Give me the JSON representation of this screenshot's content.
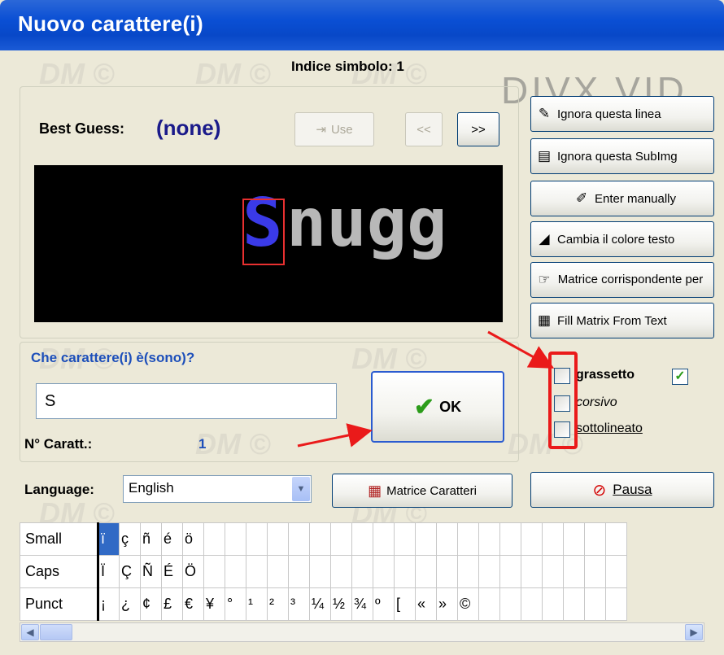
{
  "window": {
    "title": "Nuovo carattere(i)"
  },
  "watermark": {
    "text": "DM ©",
    "logo": "DIVX VID"
  },
  "symbol_index": "Indice simbolo: 1",
  "best_guess": {
    "label": "Best Guess:",
    "value": "(none)"
  },
  "nav": {
    "use_label": "Use",
    "prev_label": "<<",
    "next_label": ">>"
  },
  "preview": {
    "selected_char": "S",
    "rest_text": "nugg"
  },
  "side_buttons": [
    {
      "label": "Ignora questa linea",
      "icon": "eraser-icon"
    },
    {
      "label": "Ignora questa SubImg",
      "icon": "document-icon"
    },
    {
      "label": "Enter manually",
      "icon": "pencil-icon"
    },
    {
      "label": "Cambia il colore testo",
      "icon": "color-pen-icon"
    },
    {
      "label": "Matrice corrispondente per",
      "icon": "hand-pointer-icon"
    },
    {
      "label": "Fill Matrix From Text",
      "icon": "matrix-icon"
    }
  ],
  "question": {
    "label": "Che carattere(i) è(sono)?"
  },
  "char_input": {
    "value": "S"
  },
  "count": {
    "label": "N° Caratt.:",
    "value": "1"
  },
  "ok_button": {
    "label": "OK"
  },
  "style_checkboxes": [
    {
      "label": "grassetto",
      "checked": false,
      "extra_checked": true
    },
    {
      "label": "corsivo",
      "checked": false
    },
    {
      "label": "sottolineato",
      "checked": false
    }
  ],
  "language": {
    "label": "Language:",
    "selected": "English"
  },
  "matrix_button": {
    "label": "Matrice Caratteri"
  },
  "pause_button": {
    "label": "Pausa"
  },
  "char_table": {
    "rows": [
      {
        "name": "Small",
        "chars": [
          "ï",
          "ç",
          "ñ",
          "é",
          "ö",
          "",
          "",
          "",
          "",
          "",
          "",
          "",
          "",
          "",
          "",
          "",
          "",
          "",
          "",
          "",
          "",
          "",
          "",
          "",
          ""
        ]
      },
      {
        "name": "Caps",
        "chars": [
          "Ï",
          "Ç",
          "Ñ",
          "É",
          "Ö",
          "",
          "",
          "",
          "",
          "",
          "",
          "",
          "",
          "",
          "",
          "",
          "",
          "",
          "",
          "",
          "",
          "",
          "",
          "",
          ""
        ]
      },
      {
        "name": "Punct",
        "chars": [
          "¡",
          "¿",
          "¢",
          "£",
          "€",
          "¥",
          "°",
          "¹",
          "²",
          "³",
          "¼",
          "½",
          "¾",
          "º",
          "[",
          "«",
          "»",
          "©"
        ]
      }
    ]
  },
  "accent": {
    "title_bar": "#0a4fd4",
    "annotation_red": "#ea1a1a",
    "label_blue": "#1d4fba"
  }
}
